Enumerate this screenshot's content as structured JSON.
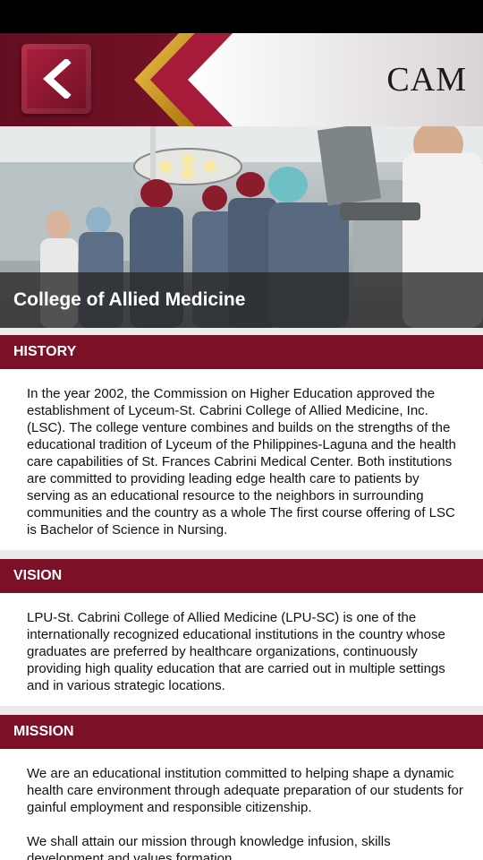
{
  "header": {
    "title": "CAM",
    "back_icon": "chevron-left-icon",
    "colors": {
      "primary": "#7b1027",
      "gold": "#c9961a"
    }
  },
  "hero": {
    "caption": "College of Allied Medicine"
  },
  "sections": [
    {
      "title": "HISTORY",
      "paragraphs": [
        "In the year 2002, the Commission on Higher Education approved the establishment of Lyceum-St. Cabrini College of Allied Medicine, Inc. (LSC). The college venture combines and builds on the strengths of the educational tradition of Lyceum of the Philippines-Laguna and the health care capabilities of St. Frances Cabrini Medical Center. Both institutions are committed to providing leading edge health care to patients by serving as an educational resource to the neighbors in surrounding communities and the country as a whole The first course offering of LSC is Bachelor of Science in Nursing."
      ]
    },
    {
      "title": "VISION",
      "paragraphs": [
        "LPU-St. Cabrini College of Allied Medicine (LPU-SC) is one of the internationally recognized educational institutions in the country whose graduates are preferred by healthcare organizations, continuously providing high quality education that are carried out in multiple settings and in various strategic locations."
      ]
    },
    {
      "title": "MISSION",
      "paragraphs": [
        "We are an educational institution committed to helping shape a dynamic health care environment through adequate preparation of our students for gainful employment and responsible citizenship.",
        "We shall attain our mission through knowledge infusion, skills development and values formation."
      ]
    }
  ]
}
